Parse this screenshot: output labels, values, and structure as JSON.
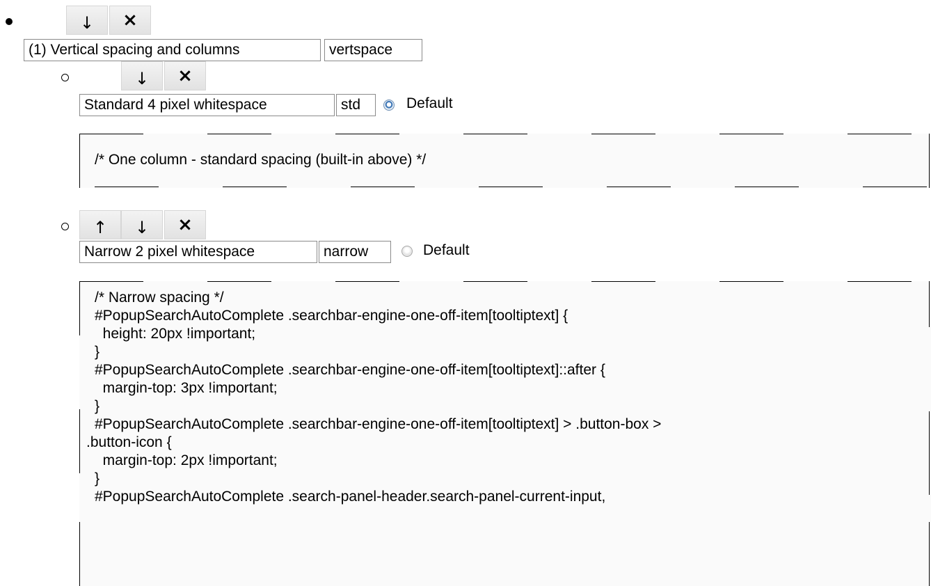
{
  "arrow_down": "↓",
  "arrow_up": "↑",
  "close": "×",
  "group": {
    "name": "(1) Vertical spacing and columns",
    "key": "vertspace"
  },
  "options": [
    {
      "name": "Standard 4 pixel whitespace",
      "key": "std",
      "default_label": "Default",
      "default_selected": true,
      "code": "/* One column - standard spacing (built-in above) */"
    },
    {
      "name": "Narrow 2 pixel whitespace",
      "key": "narrow",
      "default_label": "Default",
      "default_selected": false,
      "code_lines": [
        "/* Narrow spacing */",
        "#PopupSearchAutoComplete .searchbar-engine-one-off-item[tooltiptext] {",
        "  height: 20px !important;",
        "}",
        "#PopupSearchAutoComplete .searchbar-engine-one-off-item[tooltiptext]::after {",
        "  margin-top: 3px !important;",
        "}",
        "#PopupSearchAutoComplete .searchbar-engine-one-off-item[tooltiptext] > .button-box >",
        ".button-icon {",
        "  margin-top: 2px !important;",
        "}",
        "#PopupSearchAutoComplete .search-panel-header.search-panel-current-input,"
      ]
    }
  ],
  "colors": {
    "radio_selected": "#3a74b5",
    "field_border": "#8a8a8a",
    "code_background": "#fafafa"
  }
}
